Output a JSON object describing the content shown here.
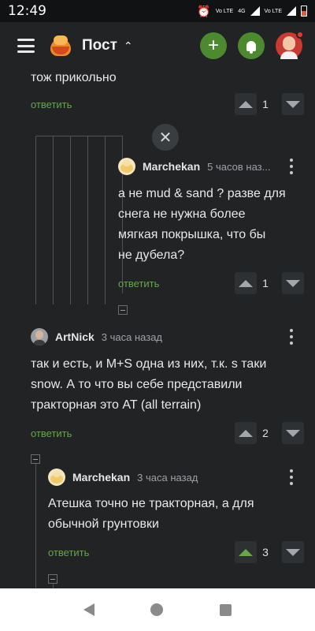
{
  "status": {
    "time": "12:49",
    "net1": "Vo LTE",
    "net2": "4G",
    "net3": "Vo LTE"
  },
  "header": {
    "title": "Пост"
  },
  "comments": [
    {
      "text": "тож прикольно",
      "reply": "ответить",
      "votes": "1"
    },
    {
      "author": "Marchekan",
      "time": "5 часов наз...",
      "text_lines": [
        "а не mud & sand ? разве для",
        "снега не нужна более",
        "мягкая покрышка, что бы",
        "не дубела?"
      ],
      "reply": "ответить",
      "votes": "1"
    },
    {
      "author": "ArtNick",
      "time": "3 часа назад",
      "text_lines": [
        "так и есть, и M+S одна из них, т.к. s таки",
        "snow. А то что вы себе представили",
        "тракторная это AT (all terrain)"
      ],
      "reply": "ответить",
      "votes": "2"
    },
    {
      "author": "Marchekan",
      "time": "3 часа назад",
      "text_lines": [
        "Атешка точно не тракторная, а для",
        "обычной грунтовки"
      ],
      "reply": "ответить",
      "votes": "3",
      "upvoted": true
    }
  ],
  "icons": {
    "menu": "menu-icon",
    "add": "plus-icon",
    "notifications": "bell-icon",
    "close": "close-icon"
  },
  "colors": {
    "reply": "#65a847",
    "add_button": "#4d8a2f",
    "background": "#212325"
  }
}
